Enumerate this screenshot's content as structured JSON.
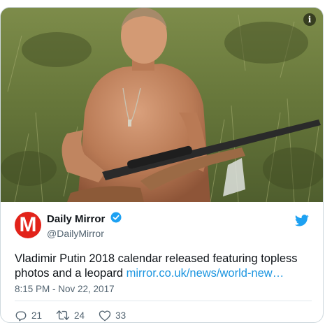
{
  "media": {
    "info_icon": "info-icon",
    "info_symbol": "i"
  },
  "author": {
    "display_name": "Daily Mirror",
    "handle": "@DailyMirror",
    "avatar_letter": "M",
    "verified_icon": "verified-badge-icon",
    "brand_color": "#e2231a"
  },
  "tweet": {
    "text": "Vladimir Putin 2018 calendar released featuring topless photos and a leopard ",
    "link": "mirror.co.uk/news/world-new…",
    "link_color": "#1b95e0",
    "timestamp": "8:15 PM - Nov 22, 2017"
  },
  "actions": {
    "reply_icon": "reply-icon",
    "reply_count": "21",
    "retweet_icon": "retweet-icon",
    "retweet_count": "24",
    "like_icon": "heart-icon",
    "like_count": "33"
  },
  "platform": {
    "logo_icon": "twitter-bird-icon",
    "accent": "#1da1f2"
  }
}
